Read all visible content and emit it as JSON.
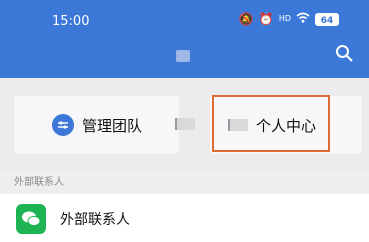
{
  "status_bar": {
    "time": "15:00",
    "battery": "64",
    "icons": [
      "mute-icon",
      "alarm-icon",
      "hd-signal-icon",
      "wifi-icon",
      "battery-icon"
    ]
  },
  "header": {
    "title": "",
    "search_icon": "search-icon"
  },
  "cards": {
    "team": {
      "label": "管理团队",
      "icon": "sliders-icon"
    },
    "personal": {
      "label": "个人中心"
    }
  },
  "section": {
    "label": "外部联系人"
  },
  "contacts": [
    {
      "label": "外部联系人",
      "icon": "wechat-icon"
    }
  ],
  "colors": {
    "brand_blue": "#3c78d8",
    "highlight": "#e06a35",
    "wechat_green": "#1fb453"
  }
}
